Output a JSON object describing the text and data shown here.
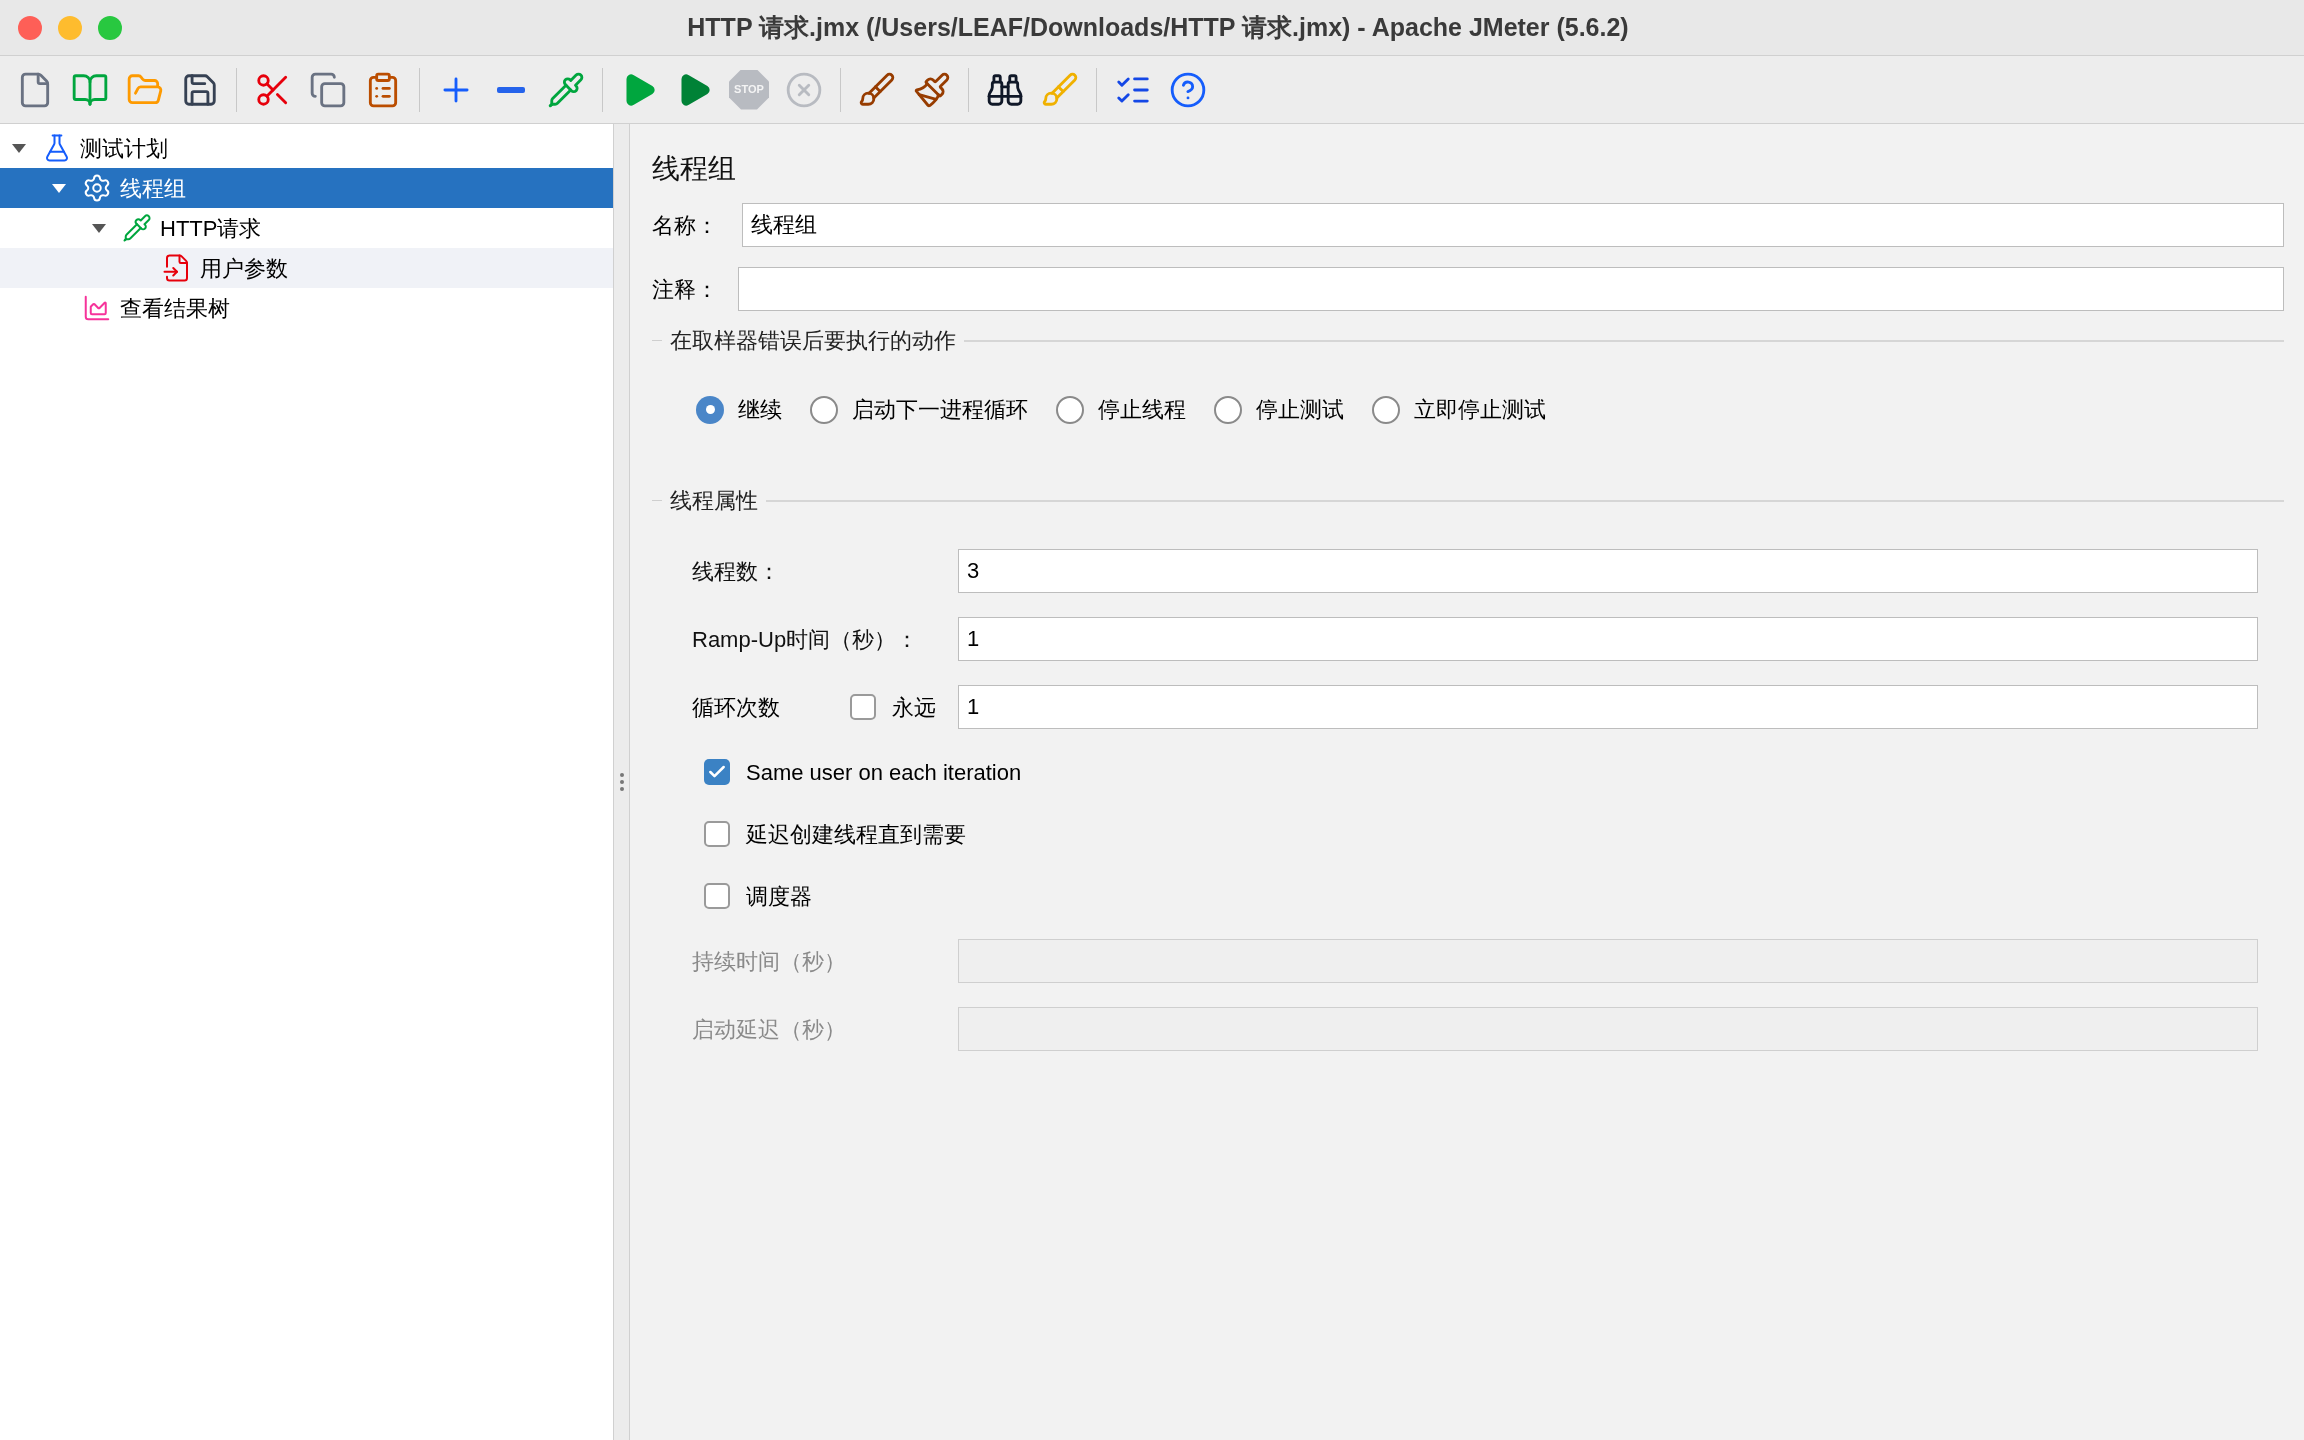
{
  "window": {
    "title": "HTTP 请求.jmx (/Users/LEAF/Downloads/HTTP 请求.jmx) - Apache JMeter (5.6.2)"
  },
  "toolbar": [
    {
      "kind": "new",
      "disabled": false
    },
    {
      "kind": "templates",
      "disabled": false
    },
    {
      "kind": "open",
      "disabled": false
    },
    {
      "kind": "save",
      "disabled": false
    },
    {
      "kind": "separator"
    },
    {
      "kind": "cut",
      "disabled": false
    },
    {
      "kind": "copy",
      "disabled": false
    },
    {
      "kind": "paste",
      "disabled": false
    },
    {
      "kind": "separator"
    },
    {
      "kind": "expand",
      "disabled": false
    },
    {
      "kind": "collapse",
      "disabled": false
    },
    {
      "kind": "toggle",
      "disabled": false
    },
    {
      "kind": "separator"
    },
    {
      "kind": "start",
      "disabled": false
    },
    {
      "kind": "start_no_timers",
      "disabled": false
    },
    {
      "kind": "stop",
      "label": "STOP",
      "disabled": true
    },
    {
      "kind": "shutdown",
      "disabled": true
    },
    {
      "kind": "separator"
    },
    {
      "kind": "clear",
      "disabled": false
    },
    {
      "kind": "clear_all",
      "disabled": false
    },
    {
      "kind": "separator"
    },
    {
      "kind": "search",
      "disabled": false
    },
    {
      "kind": "reset_search",
      "disabled": false
    },
    {
      "kind": "separator"
    },
    {
      "kind": "function_helper",
      "disabled": false
    },
    {
      "kind": "help",
      "disabled": false
    }
  ],
  "tree": [
    {
      "kind": "test_plan",
      "label": "测试计划",
      "expanded": true,
      "selected": false,
      "hovered": false,
      "children": [
        {
          "kind": "thread_group",
          "label": "线程组",
          "expanded": true,
          "selected": true,
          "hovered": false,
          "children": [
            {
              "kind": "sampler",
              "label": "HTTP请求",
              "expanded": true,
              "selected": false,
              "hovered": false,
              "children": [
                {
                  "kind": "config",
                  "label": "用户参数",
                  "selected": false,
                  "hovered": true
                }
              ]
            }
          ]
        },
        {
          "kind": "listener",
          "label": "查看结果树",
          "selected": false,
          "hovered": false
        }
      ]
    }
  ],
  "panel": {
    "title": "线程组",
    "name": {
      "label": "名称：",
      "value": "线程组"
    },
    "comment": {
      "label": "注释："
    },
    "error_action": {
      "title": "在取样器错误后要执行的动作",
      "options": [
        {
          "label": "继续",
          "selected": true
        },
        {
          "label": "启动下一进程循环",
          "selected": false
        },
        {
          "label": "停止线程",
          "selected": false
        },
        {
          "label": "停止测试",
          "selected": false
        },
        {
          "label": "立即停止测试",
          "selected": false
        }
      ]
    },
    "thread_properties": {
      "title": "线程属性",
      "rows": [
        {
          "kind": "field",
          "label": "线程数：",
          "value": "3",
          "disabled": false
        },
        {
          "kind": "field",
          "label": "Ramp-Up时间（秒）：",
          "value": "1",
          "disabled": false
        },
        {
          "kind": "loop",
          "label": "循环次数",
          "checkbox": {
            "label": "永远",
            "checked": false
          },
          "value": "1"
        },
        {
          "kind": "checkbox",
          "label": "Same user on each iteration",
          "checked": true
        },
        {
          "kind": "checkbox",
          "label": "延迟创建线程直到需要",
          "checked": false
        },
        {
          "kind": "checkbox",
          "label": "调度器",
          "checked": false
        },
        {
          "kind": "field",
          "label": "持续时间（秒）",
          "disabled": true
        },
        {
          "kind": "field",
          "label": "启动延迟（秒）",
          "disabled": true
        }
      ]
    }
  }
}
